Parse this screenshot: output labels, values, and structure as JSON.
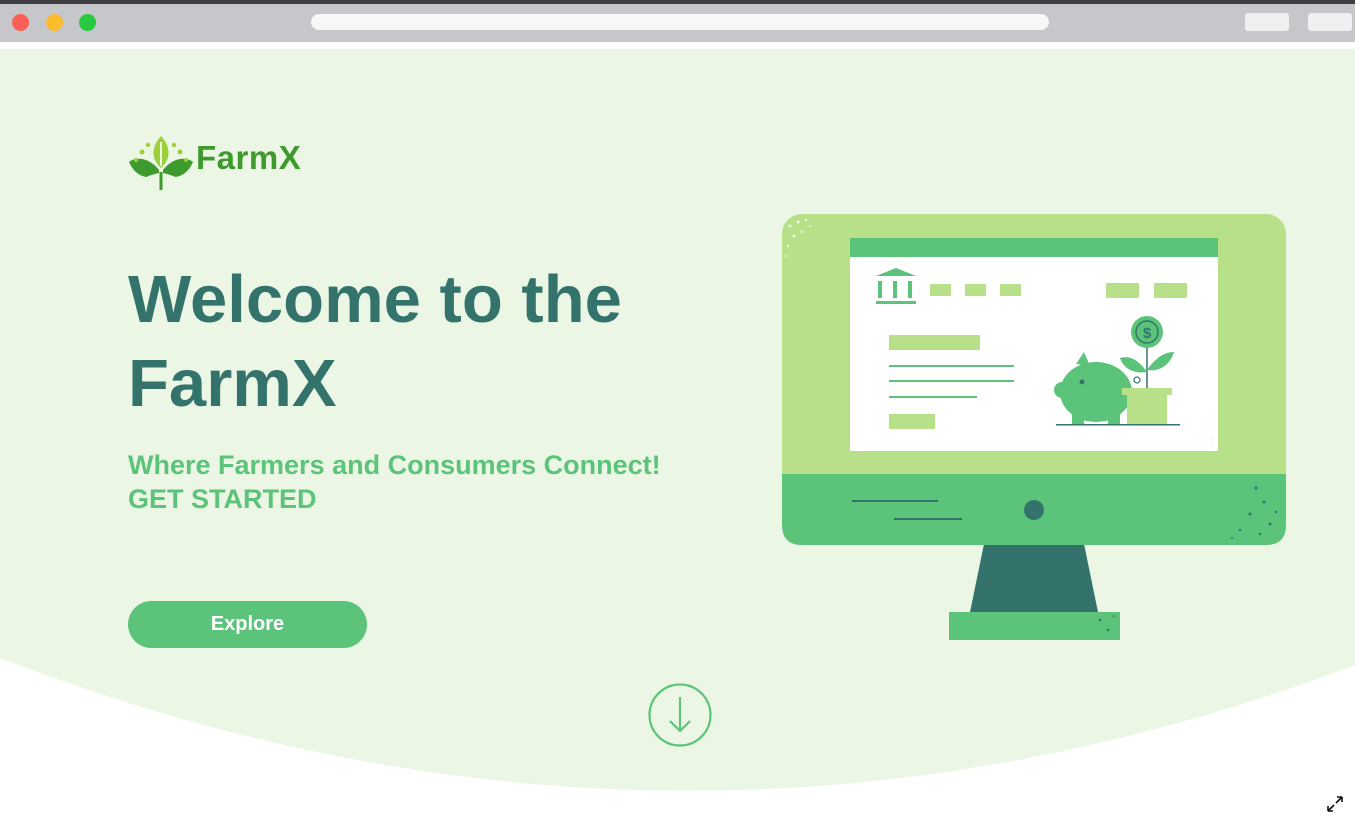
{
  "brand": {
    "name": "FarmX"
  },
  "hero": {
    "title_line1": "Welcome to the",
    "title_line2": "FarmX",
    "tagline_line1": "Where Farmers and Consumers Connect!",
    "tagline_line2": "GET STARTED",
    "cta_label": "Explore"
  },
  "icons": {
    "logo": "leaf-sprout-icon",
    "scroll": "arrow-down-circle-icon",
    "expand": "expand-icon",
    "illustration": "monitor-piggy-bank-illustration"
  },
  "colors": {
    "background": "#ecf6e4",
    "title": "#33736c",
    "accent": "#5cc47a",
    "logo_text": "#3f9a2e",
    "light_green": "#b8e089"
  }
}
